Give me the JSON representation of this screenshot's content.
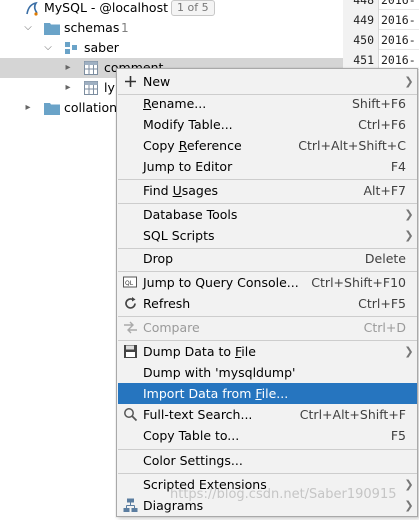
{
  "tree": {
    "connection": {
      "label": "MySQL - @localhost",
      "badge": "1 of 5"
    },
    "schemas": {
      "label": "schemas",
      "count": "1"
    },
    "schema": {
      "label": "saber"
    },
    "table_comment": {
      "label": "comment"
    },
    "table_lyr": {
      "label": "lyr"
    },
    "collations": {
      "label": "collations"
    }
  },
  "grid": {
    "rows": [
      {
        "num": "448",
        "value": "2016-"
      },
      {
        "num": "449",
        "value": "2016-"
      },
      {
        "num": "450",
        "value": "2016-"
      },
      {
        "num": "451",
        "value": "2016-"
      }
    ]
  },
  "menu": {
    "new": {
      "label": "New"
    },
    "rename": {
      "pre": "",
      "u": "R",
      "post": "ename...",
      "shortcut": "Shift+F6"
    },
    "modify_table": {
      "label": "Modify Table...",
      "shortcut": "Ctrl+F6"
    },
    "copy_reference": {
      "pre": "Copy ",
      "u": "R",
      "post": "eference",
      "shortcut": "Ctrl+Alt+Shift+C"
    },
    "jump_to_editor": {
      "label": "Jump to Editor",
      "shortcut": "F4"
    },
    "find_usages": {
      "pre": "Find ",
      "u": "U",
      "post": "sages",
      "shortcut": "Alt+F7"
    },
    "database_tools": {
      "label": "Database Tools"
    },
    "sql_scripts": {
      "label": "SQL Scripts"
    },
    "drop": {
      "label": "Drop",
      "shortcut": "Delete"
    },
    "jump_to_console": {
      "label": "Jump to Query Console...",
      "shortcut": "Ctrl+Shift+F10"
    },
    "refresh": {
      "label": "Refresh",
      "shortcut": "Ctrl+F5"
    },
    "compare": {
      "label": "Compare",
      "shortcut": "Ctrl+D"
    },
    "dump_to_file": {
      "pre": "Dump Data to ",
      "u": "F",
      "post": "ile"
    },
    "dump_mysqldump": {
      "label": "Dump with 'mysqldump'"
    },
    "import_data": {
      "pre": "Import Data from ",
      "u": "F",
      "post": "ile..."
    },
    "fulltext_search": {
      "label": "Full-text Search...",
      "shortcut": "Ctrl+Alt+Shift+F"
    },
    "copy_table": {
      "label": "Copy Table to...",
      "shortcut": "F5"
    },
    "color_settings": {
      "label": "Color Settings..."
    },
    "scripted_extensions": {
      "label": "Scripted Extensions"
    },
    "diagrams": {
      "label": "Diagrams"
    }
  },
  "watermark": "https://blog.csdn.net/Saber190915",
  "colors": {
    "highlight": "#2675bf",
    "folder": "#6aa3c8",
    "table_icon": "#7d8ea0"
  }
}
